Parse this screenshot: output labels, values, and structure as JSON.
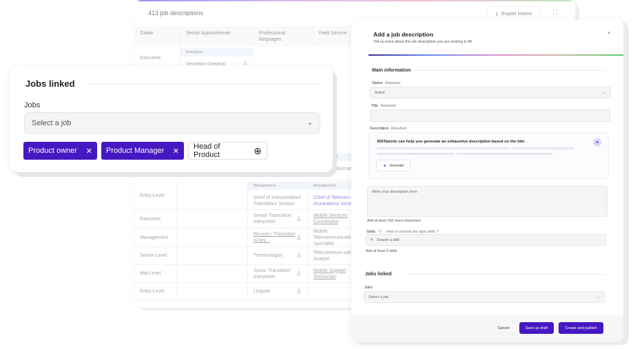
{
  "matrix": {
    "title": "413 job descriptions",
    "export_label": "Export Matrix",
    "columns": [
      "Grade",
      "Senior Appointments",
      "Professional languages",
      "Field Service"
    ],
    "top_row": {
      "grade": "Executive",
      "band": "Executive",
      "job": "Secretary-General"
    },
    "partial_band": "Management",
    "partial_cell": "Chief of Information and..",
    "bands": [
      "Management",
      "Management"
    ],
    "rows": [
      {
        "grade": "Entry-Level",
        "prof": "Chief of Interpretation/ Translation Section",
        "field": "Chief of Telecom-munications Section"
      },
      {
        "grade": "Executive",
        "prof": "Senior Translator/ Interpreter",
        "field": "Mobile Services Coordinator"
      },
      {
        "grade": "Management",
        "prof": "Reviser / Translator /Copy...",
        "field": "Mobile Telecommunications Specialist"
      },
      {
        "grade": "Senior-Level",
        "prof": "Terminologist",
        "field": "Telecommuni-cations Analyst"
      },
      {
        "grade": "Mid-Level",
        "prof": "Junior Translator/ Interpreter",
        "field": "Mobile Support Technician"
      },
      {
        "grade": "Entry-Level",
        "prof": "Linguist",
        "field": ""
      }
    ]
  },
  "card": {
    "title": "Jobs linked",
    "jobs_label": "Jobs",
    "placeholder": "Select a job",
    "tags": [
      {
        "label": "Product owner",
        "selected": true
      },
      {
        "label": "Product Manager",
        "selected": true
      },
      {
        "label": "Head of Product",
        "selected": false
      }
    ]
  },
  "modal": {
    "title": "Add a job description",
    "subtitle": "Tell us more about the job description you are looking to fill.",
    "close": "×",
    "main_section": "Main information",
    "status_label": "Status",
    "required": "Required",
    "status_value": "Active",
    "title_label": "Title",
    "description_label": "Description",
    "ai_text": "365Talents can help you generate an exhaustive description based on the title",
    "generate": "Generate",
    "description_placeholder": "Write your description here",
    "description_hint": "Add at least 150 more characters",
    "skills_label": "Skills",
    "skills_help": "How to choose the right skills ?",
    "skills_placeholder": "Search a skill",
    "skills_hint": "Add at least 4 skills",
    "jobs_section": "Jobs linked",
    "jobs_label": "Jobs",
    "jobs_placeholder": "Select a job",
    "cancel": "Cancel",
    "save_draft": "Save as draft",
    "publish": "Create and publish"
  },
  "colors": {
    "accent": "#4518c1",
    "link": "#7b5ce0"
  }
}
